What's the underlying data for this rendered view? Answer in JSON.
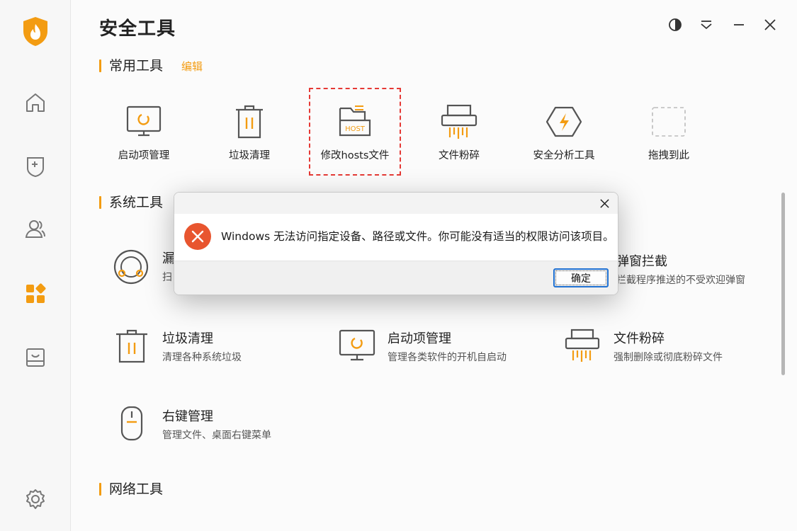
{
  "app": {
    "title": "安全工具"
  },
  "colors": {
    "accent": "#f39c12",
    "error": "#e8552f",
    "dialog_button_border": "#1e6fd0"
  },
  "sidebar": {
    "items": [
      {
        "icon": "home-icon"
      },
      {
        "icon": "shield-plus-icon"
      },
      {
        "icon": "users-icon"
      },
      {
        "icon": "tools-grid-icon",
        "active": true
      },
      {
        "icon": "tray-icon"
      },
      {
        "icon": "gear-icon"
      }
    ]
  },
  "sections": {
    "common": {
      "title": "常用工具",
      "edit": "编辑"
    },
    "system": {
      "title": "系统工具"
    },
    "network": {
      "title": "网络工具"
    }
  },
  "common_tools": [
    {
      "label": "启动项管理",
      "icon": "monitor-startup-icon"
    },
    {
      "label": "垃圾清理",
      "icon": "trash-icon"
    },
    {
      "label": "修改hosts文件",
      "icon": "hosts-file-icon",
      "highlighted": true
    },
    {
      "label": "文件粉碎",
      "icon": "shredder-icon"
    },
    {
      "label": "安全分析工具",
      "icon": "shield-bolt-icon"
    },
    {
      "label": "拖拽到此",
      "icon": "drop-placeholder-icon"
    }
  ],
  "system_tools": [
    {
      "title": "漏",
      "desc": "扫",
      "icon": "loophole-scan-icon"
    },
    {
      "title": "弹窗拦截",
      "desc": "拦截程序推送的不受欢迎弹窗",
      "icon": "popup-block-icon"
    },
    {
      "title": "垃圾清理",
      "desc": "清理各种系统垃圾",
      "icon": "trash-icon"
    },
    {
      "title": "启动项管理",
      "desc": "管理各类软件的开机自启动",
      "icon": "monitor-startup-icon"
    },
    {
      "title": "文件粉碎",
      "desc": "强制删除或彻底粉碎文件",
      "icon": "shredder-icon"
    },
    {
      "title": "右键管理",
      "desc": "管理文件、桌面右键菜单",
      "icon": "mouse-icon"
    }
  ],
  "dialog": {
    "message": "Windows 无法访问指定设备、路径或文件。你可能没有适当的权限访问该项目。",
    "ok_label": "确定"
  }
}
